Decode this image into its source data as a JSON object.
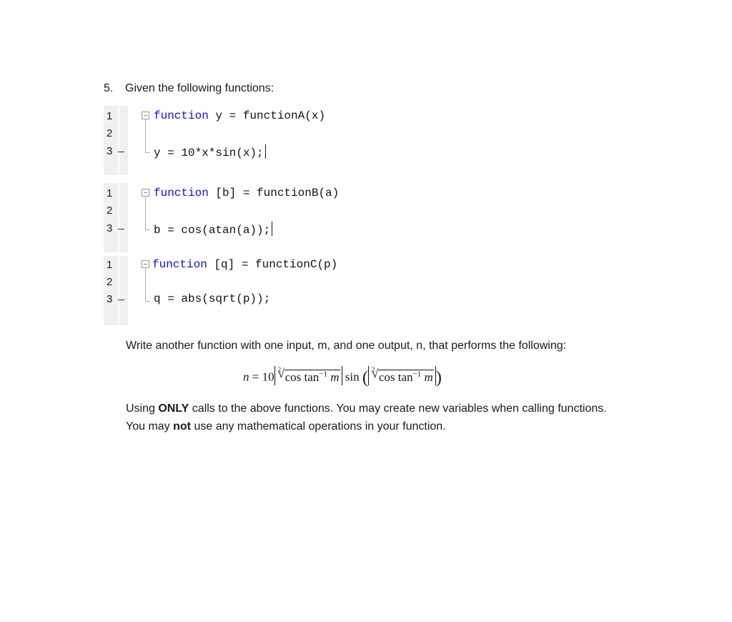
{
  "question": {
    "number": "5.",
    "heading": "Given the following functions:"
  },
  "code_blocks": [
    {
      "line_numbers": [
        "1",
        "2",
        "3"
      ],
      "line1_keyword": "function",
      "line1_rest": " y = functionA(x)",
      "line3": "y = 10*x*sin(x);"
    },
    {
      "line_numbers": [
        "1",
        "2",
        "3"
      ],
      "line1_keyword": "function",
      "line1_rest": " [b] = functionB(a)",
      "line3": "b = cos(atan(a));"
    },
    {
      "line_numbers": [
        "1",
        "2",
        "3"
      ],
      "line1_keyword": "function",
      "line1_rest": " [q] = functionC(p)",
      "line3": "q = abs(sqrt(p));"
    }
  ],
  "instructions": {
    "prompt": "Write another function with one input, m, and one output, n, that performs the following:",
    "equation": {
      "lhs": "n",
      "equals": "=",
      "coef": "10",
      "root_index": "2",
      "radicand_text": "cos tan",
      "inverse_exp": "−1",
      "var": "m",
      "sin": "sin"
    },
    "line1_pre": "Using ",
    "line1_bold": "ONLY",
    "line1_post": " calls to the above functions. You may create new variables when calling functions.",
    "line2_pre": "You may ",
    "line2_bold": "not",
    "line2_post": " use any mathematical operations in your function."
  }
}
